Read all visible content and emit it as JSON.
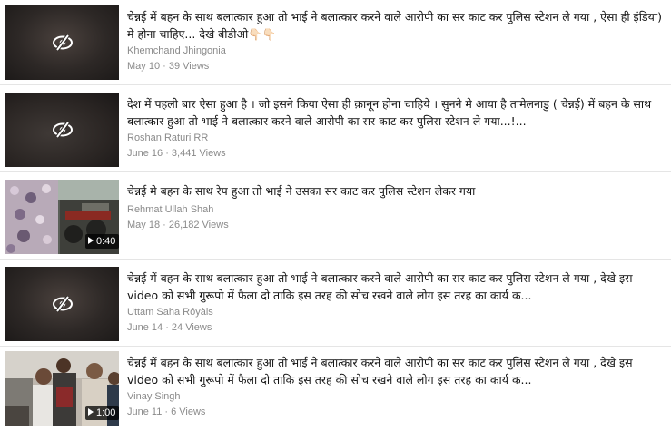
{
  "results": [
    {
      "title": "चेन्नई में बहन के साथ बलात्कार हुआ तो भाई ने बलात्कार करने वाले आरोपी का सर काट कर पुलिस स्टेशन ले गया , ऐसा ही इंडिया) मे होना चाहिए... देखे बीडीओ👇🏻👇🏻",
      "channel": "Khemchand Jhingonia",
      "meta": "May 10 · 39 Views",
      "thumb": "hidden",
      "duration": ""
    },
    {
      "title": "देश में पहली बार ऐसा हुआ है । जो इसने किया ऐसा ही क़ानून होना चाहिये । सुनने मे आया है तामेलनाडु ( चेन्नई) में बहन के साथ बलात्कार हुआ तो भाई ने बलात्कार करने वाले आरोपी का सर काट कर पुलिस स्टेशन ले गया...!...",
      "channel": "Roshan Raturi RR",
      "meta": "June 16 · 3,441 Views",
      "thumb": "hidden",
      "duration": ""
    },
    {
      "title": "चेन्नई मे बहन के साथ रेप हुआ तो भाई ने उसका सर काट कर पुलिस स्टेशन लेकर गया",
      "channel": "Rehmat Ullah Shah",
      "meta": "May 18 · 26,182 Views",
      "thumb": "video",
      "duration": "0:40"
    },
    {
      "title": "चेन्नई में बहन के साथ बलात्कार हुआ तो भाई ने बलात्कार करने वाले आरोपी का सर काट कर पुलिस स्टेशन ले गया , देखे इस video को सभी गुरूपो में फैला दो ताकि इस तरह की सोच रखने वाले लोग इस तरह का कार्य क...",
      "channel": "Uttam Saha Róyàls",
      "meta": "June 14 · 24 Views",
      "thumb": "hidden",
      "duration": ""
    },
    {
      "title": "चेन्नई में बहन के साथ बलात्कार हुआ तो भाई ने बलात्कार करने वाले आरोपी का सर काट कर पुलिस स्टेशन ले गया , देखे इस video को सभी गुरूपो में फैला दो ताकि इस तरह की सोच रखने वाले लोग इस तरह का कार्य क...",
      "channel": "Vinay Singh",
      "meta": "June 11 · 6 Views",
      "thumb": "video",
      "duration": "1:00"
    }
  ]
}
